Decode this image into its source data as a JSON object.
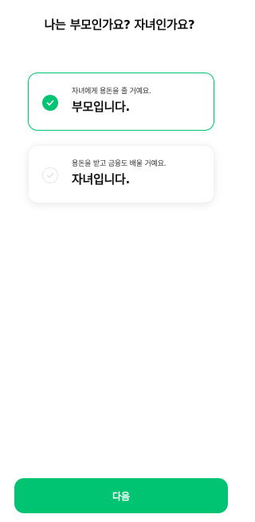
{
  "page": {
    "title": "나는 부모인가요? 자녀인가요?"
  },
  "options": [
    {
      "sub": "자녀에게 용돈을 줄 거예요.",
      "main": "부모입니다.",
      "selected": true,
      "icon": "check-circle-filled-icon"
    },
    {
      "sub": "용돈을 받고 금융도 배울 거예요.",
      "main": "자녀입니다.",
      "selected": false,
      "icon": "check-circle-outline-icon"
    }
  ],
  "footer": {
    "next_label": "다음"
  },
  "colors": {
    "accent": "#00c471",
    "text": "#111111",
    "muted_check": "#e6e6e6"
  }
}
